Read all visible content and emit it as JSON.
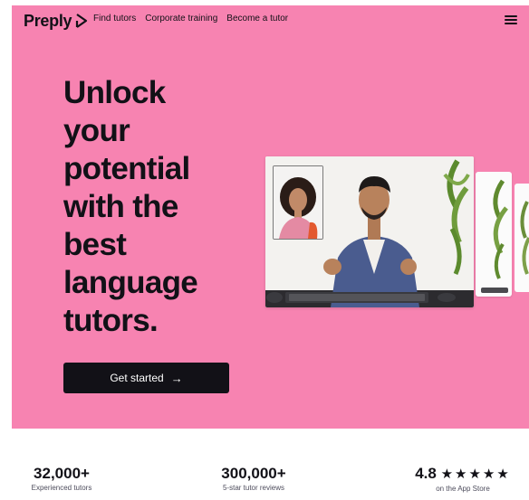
{
  "nav": {
    "logo_text": "Preply",
    "links": [
      "Find tutors",
      "Corporate training",
      "Become a tutor"
    ]
  },
  "hero": {
    "headline": "Unlock\nyour\npotential\nwith the\nbest\nlanguage\ntutors.",
    "cta_label": "Get started",
    "cta_arrow": "→"
  },
  "stats": [
    {
      "value": "32,000+",
      "label": "Experienced tutors"
    },
    {
      "value": "300,000+",
      "label": "5-star tutor reviews"
    },
    {
      "value": "4.8",
      "stars": "★★★★★",
      "label": "on the App Store"
    }
  ],
  "colors": {
    "hero_bg": "#f783b1",
    "text_dark": "#121117",
    "cta_bg": "#121117"
  },
  "icons": {
    "logo": "preply-arrow-icon",
    "menu": "hamburger-menu-icon",
    "cta": "arrow-right-icon",
    "rating": "star-icon"
  }
}
